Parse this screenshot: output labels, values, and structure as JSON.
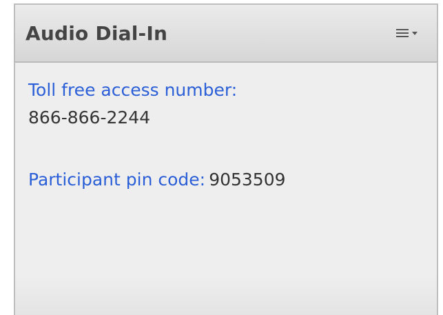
{
  "pod": {
    "title": "Audio Dial-In",
    "menu_icon": "menu-lines-with-dropdown-caret"
  },
  "dial_in": {
    "toll_free_label": "Toll free access number:",
    "toll_free_number": "866-866-2244",
    "pin_label": "Participant pin code:",
    "pin_code": "9053509"
  },
  "colors": {
    "label_blue": "#2b5fd7",
    "text_dark": "#333333",
    "panel_bg": "#eeeeee"
  }
}
